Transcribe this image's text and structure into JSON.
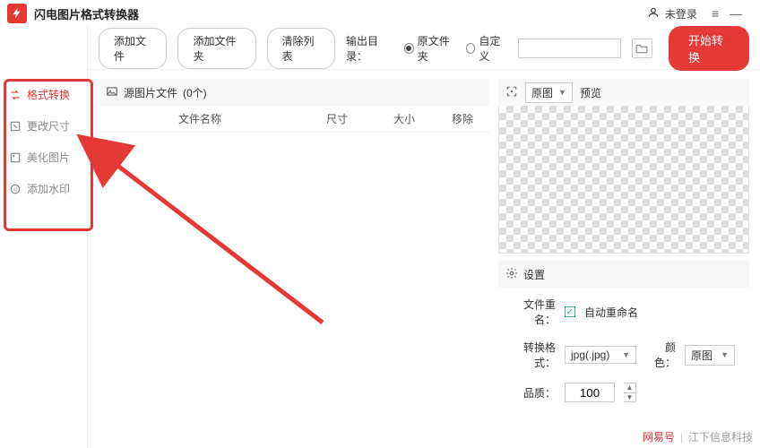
{
  "titlebar": {
    "app_name": "闪电图片格式转换器",
    "login_text": "未登录"
  },
  "sidebar": {
    "items": [
      {
        "label": "格式转换"
      },
      {
        "label": "更改尺寸"
      },
      {
        "label": "美化图片"
      },
      {
        "label": "添加水印"
      }
    ]
  },
  "toolbar": {
    "add_file": "添加文件",
    "add_folder": "添加文件夹",
    "clear_list": "清除列表",
    "output_label": "输出目录：",
    "radio_original": "原文件夹",
    "radio_custom": "自定义",
    "start_btn": "开始转换"
  },
  "source": {
    "header_prefix": "源图片文件",
    "count_text": "(0个)",
    "col_name": "文件名称",
    "col_dim": "尺寸",
    "col_size": "大小",
    "col_remove": "移除"
  },
  "preview": {
    "dropdown": "原图",
    "label": "预览"
  },
  "settings": {
    "title": "设置",
    "rename_label": "文件重名：",
    "rename_auto": "自动重命名",
    "format_label": "转换格式：",
    "format_value": "jpg(.jpg)",
    "color_label": "颜色：",
    "color_value": "原图",
    "quality_label": "品质：",
    "quality_value": "100"
  },
  "footer": {
    "brand": "网易号",
    "author": "江下信息科技"
  }
}
